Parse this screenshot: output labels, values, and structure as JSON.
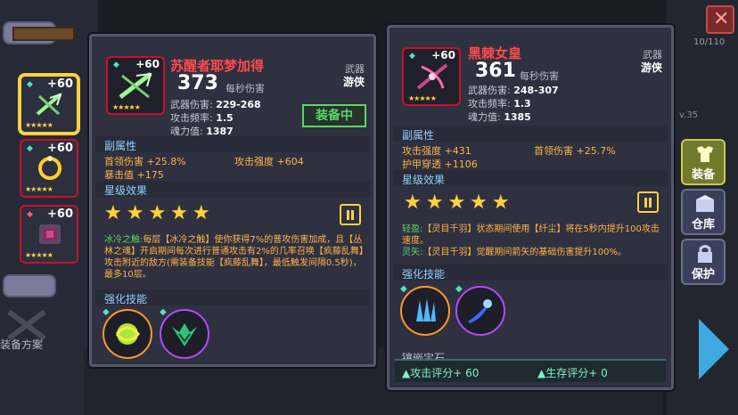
{
  "side": {
    "slots": [
      {
        "plus": "+60",
        "stars": "★★★★★",
        "art": "crossbow"
      },
      {
        "plus": "+60",
        "stars": "★★★★★",
        "art": "ring"
      },
      {
        "plus": "+60",
        "stars": "★★★★★",
        "art": "armor"
      }
    ],
    "plan_label": "装备方案"
  },
  "left_card": {
    "plus": "+60",
    "stars": "★★★★★",
    "name": "苏醒者耶梦加得",
    "dps": "373",
    "dps_unit": "每秒伤害",
    "category_label": "武器",
    "category_value": "游侠",
    "stats": [
      {
        "label": "武器伤害:",
        "value": "229-268"
      },
      {
        "label": "攻击频率:",
        "value": "1.5"
      },
      {
        "label": "魂力值:",
        "value": "1387"
      }
    ],
    "equipped_label": "装备中",
    "attr_title": "副属性",
    "attrs": [
      {
        "label": "首领伤害",
        "value": "+25.8%"
      },
      {
        "label": "攻击强度",
        "value": "+604"
      },
      {
        "label": "暴击值",
        "value": "+175"
      }
    ],
    "star_title": "星级效果",
    "big_stars": "★★★★★",
    "desc_key": "冰冷之触:",
    "desc": "每层【冰冷之触】使你获得7%的普攻伤害加成，且【丛林之魂】开启期间每次进行普通攻击有2%的几率召唤【疯藤乱舞】攻击附近的敌方(需装备技能【疯藤乱舞】，最低触发间隔0.5秒)，最多10层。",
    "skill_title": "强化技能",
    "skills": [
      {
        "icon": "vine-orb-icon"
      },
      {
        "icon": "leaf-mask-icon"
      }
    ]
  },
  "right_card": {
    "plus": "+60",
    "stars": "★★★★★",
    "name": "黑棘女皇",
    "dps": "361",
    "dps_unit": "每秒伤害",
    "category_label": "武器",
    "category_value": "游侠",
    "stats": [
      {
        "label": "武器伤害:",
        "value": "248-307"
      },
      {
        "label": "攻击频率:",
        "value": "1.3"
      },
      {
        "label": "魂力值:",
        "value": "1385"
      }
    ],
    "attr_title": "副属性",
    "attrs": [
      {
        "label": "攻击强度",
        "value": "+431"
      },
      {
        "label": "首领伤害",
        "value": "+25.7%"
      },
      {
        "label": "护甲穿透",
        "value": "+1106"
      }
    ],
    "star_title": "星级效果",
    "big_stars": "★★★★★",
    "effects": [
      {
        "key": "轻盈:",
        "text": "【灵目千羽】状态期间使用【纤尘】将在5秒内提升100攻击速度。"
      },
      {
        "key": "灵矢:",
        "text": "【灵目千羽】觉醒期间箭矢的基础伤害提升100%。"
      }
    ],
    "skill_title": "强化技能",
    "skills": [
      {
        "icon": "ice-shards-icon"
      },
      {
        "icon": "blue-comet-icon"
      }
    ],
    "gem_title": "镶嵌宝石",
    "score_attack": "攻击评分+ 60",
    "score_survive": "生存评分+ 0"
  },
  "menu": {
    "close": "✕",
    "count": "10/110",
    "lv": "v.35",
    "equip": "装备",
    "storage": "仓库",
    "protect": "保护"
  },
  "colors": {
    "accent_red": "#ff4b4b",
    "accent_gold": "#ffd23f",
    "accent_green": "#5fd36a",
    "accent_orange": "#ffb347"
  }
}
